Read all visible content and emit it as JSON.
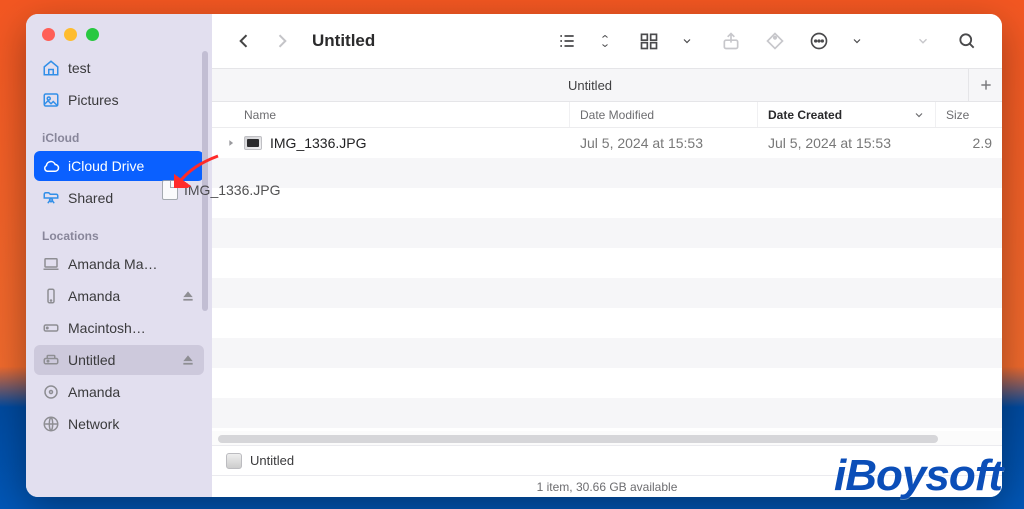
{
  "window": {
    "title": "Untitled"
  },
  "traffic": {
    "close": "close",
    "minimize": "minimize",
    "zoom": "zoom"
  },
  "sidebar": {
    "sections": [
      {
        "header": null,
        "items": [
          {
            "icon": "home-icon",
            "label": "test",
            "state": "default"
          },
          {
            "icon": "photo-icon",
            "label": "Pictures",
            "state": "default"
          }
        ]
      },
      {
        "header": "iCloud",
        "items": [
          {
            "icon": "cloud-icon",
            "label": "iCloud Drive",
            "state": "selected"
          },
          {
            "icon": "shared-folder-icon",
            "label": "Shared",
            "state": "default"
          }
        ]
      },
      {
        "header": "Locations",
        "items": [
          {
            "icon": "laptop-icon",
            "label": "Amanda Ma…",
            "state": "default"
          },
          {
            "icon": "phone-icon",
            "label": "Amanda",
            "state": "default",
            "eject": true
          },
          {
            "icon": "hdd-icon",
            "label": "Macintosh…",
            "state": "default"
          },
          {
            "icon": "ext-disk-icon",
            "label": "Untitled",
            "state": "active",
            "eject": true
          },
          {
            "icon": "disk-icon",
            "label": "Amanda",
            "state": "default"
          },
          {
            "icon": "globe-icon",
            "label": "Network",
            "state": "default"
          }
        ]
      }
    ]
  },
  "toolbar": {
    "back": "back",
    "forward": "forward",
    "view_list": "list",
    "view_group": "group",
    "share": "share",
    "tags": "tags",
    "more": "more",
    "chevdown": "open",
    "search": "search"
  },
  "tabs": {
    "items": [
      {
        "label": "Untitled"
      }
    ],
    "add": "+"
  },
  "columns": {
    "name": "Name",
    "date_modified": "Date Modified",
    "date_created": "Date Created",
    "size": "Size",
    "sorted": "date_created"
  },
  "rows": [
    {
      "name": "IMG_1336.JPG",
      "date_modified": "Jul 5, 2024 at 15:53",
      "date_created": "Jul 5, 2024 at 15:53",
      "size": "2.9"
    }
  ],
  "drag_ghost": {
    "label": "IMG_1336.JPG"
  },
  "path_bar": {
    "label": "Untitled"
  },
  "status_bar": {
    "text": "1 item, 30.66 GB available"
  },
  "watermark": {
    "text": "iBoysoft"
  },
  "colors": {
    "accent": "#0a60ff",
    "sidebar_bg": "#e2dfef",
    "sidebar_icon": "#328fe8"
  }
}
